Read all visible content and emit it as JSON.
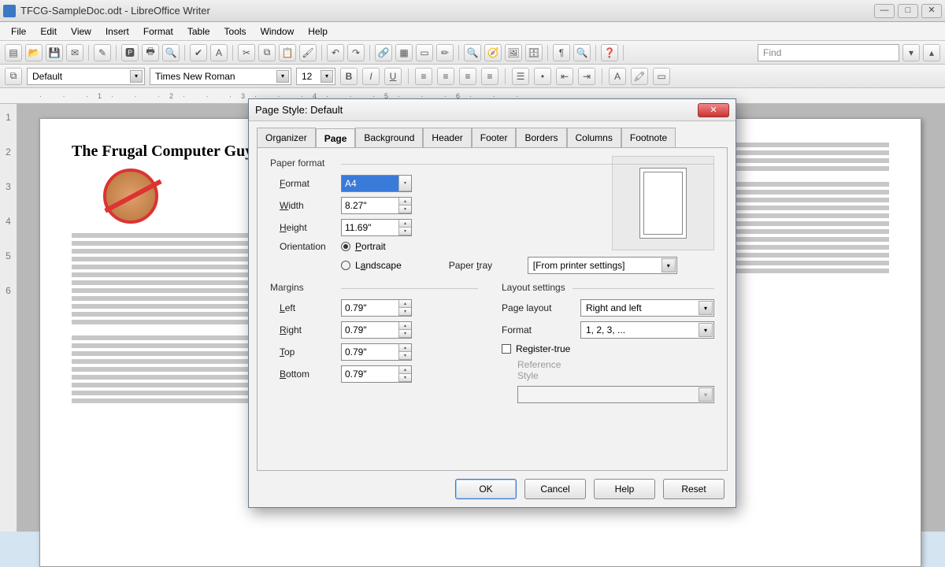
{
  "window": {
    "title": "TFCG-SampleDoc.odt - LibreOffice Writer"
  },
  "menu": [
    "File",
    "Edit",
    "View",
    "Insert",
    "Format",
    "Table",
    "Tools",
    "Window",
    "Help"
  ],
  "find_placeholder": "Find",
  "style_combo": "Default",
  "font_combo": "Times New Roman",
  "font_size_combo": "12",
  "document": {
    "heading": "The Frugal Computer Guy"
  },
  "dialog": {
    "title": "Page Style: Default",
    "tabs": [
      "Organizer",
      "Page",
      "Background",
      "Header",
      "Footer",
      "Borders",
      "Columns",
      "Footnote"
    ],
    "active_tab": "Page",
    "paper_format": {
      "group": "Paper format",
      "format_label": "Format",
      "format_value": "A4",
      "width_label": "Width",
      "width_value": "8.27\"",
      "height_label": "Height",
      "height_value": "11.69\"",
      "orientation_label": "Orientation",
      "portrait": "Portrait",
      "landscape": "Landscape",
      "paper_tray_label": "Paper tray",
      "paper_tray_value": "[From printer settings]"
    },
    "margins": {
      "group": "Margins",
      "left_label": "Left",
      "left_value": "0.79\"",
      "right_label": "Right",
      "right_value": "0.79\"",
      "top_label": "Top",
      "top_value": "0.79\"",
      "bottom_label": "Bottom",
      "bottom_value": "0.79\""
    },
    "layout": {
      "group": "Layout settings",
      "page_layout_label": "Page layout",
      "page_layout_value": "Right and left",
      "format_label": "Format",
      "format_value": "1, 2, 3, ...",
      "register_true": "Register-true",
      "reference_style": "Reference Style"
    },
    "buttons": {
      "ok": "OK",
      "cancel": "Cancel",
      "help": "Help",
      "reset": "Reset"
    }
  }
}
